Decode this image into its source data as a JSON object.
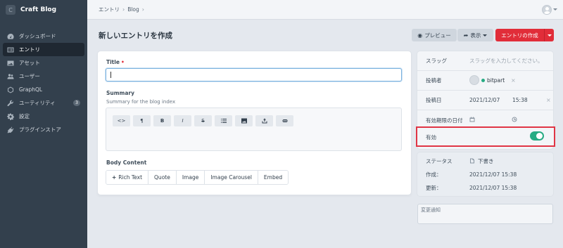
{
  "app": {
    "name": "Craft Blog",
    "logo_letter": "C"
  },
  "sidebar": {
    "items": [
      {
        "label": "ダッシュボード",
        "icon": "gauge-icon",
        "active": false
      },
      {
        "label": "エントリ",
        "icon": "entries-icon",
        "active": true
      },
      {
        "label": "アセット",
        "icon": "image-icon",
        "active": false
      },
      {
        "label": "ユーザー",
        "icon": "users-icon",
        "active": false
      },
      {
        "label": "GraphQL",
        "icon": "graphql-icon",
        "active": false
      },
      {
        "label": "ユーティリティ",
        "icon": "wrench-icon",
        "active": false,
        "badge": "3"
      },
      {
        "label": "設定",
        "icon": "gear-icon",
        "active": false
      },
      {
        "label": "プラグインストア",
        "icon": "plug-icon",
        "active": false
      }
    ]
  },
  "breadcrumb": {
    "items": [
      "エントリ",
      "Blog"
    ],
    "separator": "›"
  },
  "header": {
    "title": "新しいエントリを作成",
    "preview_label": "プレビュー",
    "view_label": "表示",
    "save_label": "エントリの作成"
  },
  "form": {
    "title_label": "Title",
    "title_required": "•",
    "title_value": "",
    "summary_label": "Summary",
    "summary_help": "Summary for the blog index",
    "toolbar": [
      "<>",
      "¶",
      "B",
      "I",
      "S",
      "list-icon",
      "image-icon",
      "upload-icon",
      "link-icon"
    ],
    "body_label": "Body Content",
    "blocks": [
      "Rich Text",
      "Quote",
      "Image",
      "Image Carousel",
      "Embed"
    ],
    "add_symbol": "+"
  },
  "meta": {
    "slug_label": "スラッグ",
    "slug_placeholder": "スラッグを入力してください。",
    "author_label": "投稿者",
    "author_name": "bitpart",
    "post_date_label": "投稿日",
    "post_date": "2021/12/07",
    "post_time": "15:38",
    "expiry_label": "有効期限の日付",
    "enabled_label": "有効",
    "enabled": true,
    "remove_symbol": "×"
  },
  "status": {
    "status_label": "ステータス",
    "status_value": "下書き",
    "created_label": "作成：",
    "created_value": "2021/12/07 15:38",
    "updated_label": "更新：",
    "updated_value": "2021/12/07 15:38"
  },
  "notes": {
    "placeholder": "変更通知"
  },
  "colors": {
    "accent": "#e12d39",
    "success": "#27ab83",
    "sidebar": "#33404d",
    "highlight_border": "#e03545"
  }
}
